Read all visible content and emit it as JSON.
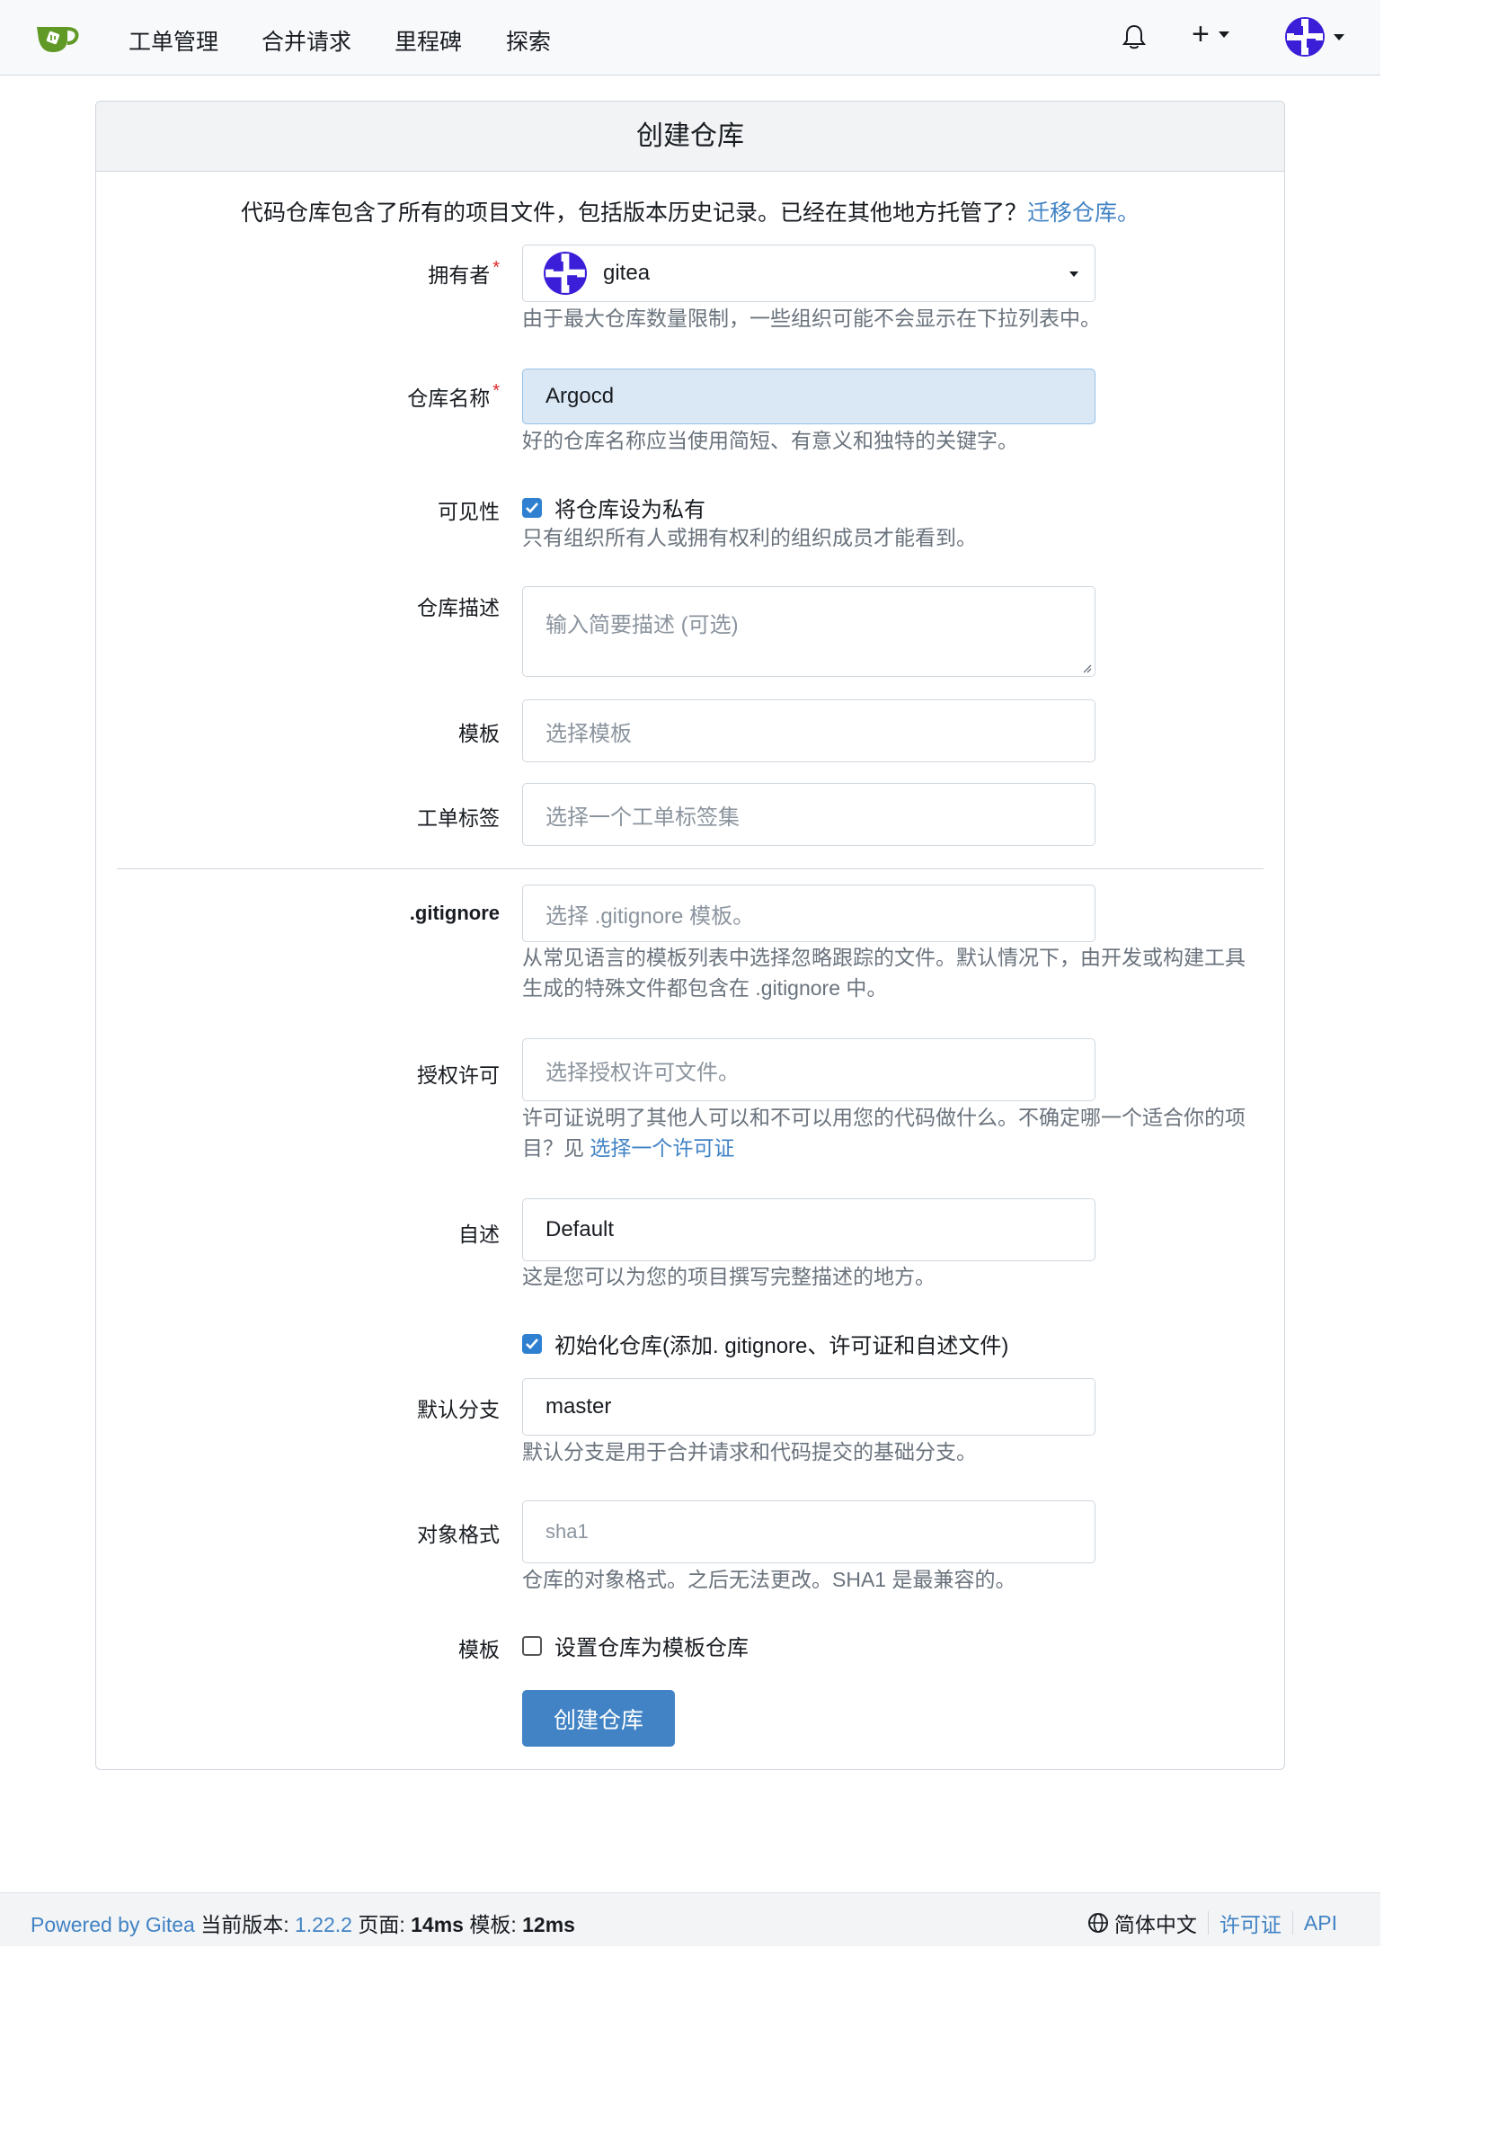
{
  "nav": {
    "items": [
      "工单管理",
      "合并请求",
      "里程碑",
      "探索"
    ],
    "plus_label": "+"
  },
  "page": {
    "title": "创建仓库",
    "intro_text": "代码仓库包含了所有的项目文件，包括版本历史记录。已经在其他地方托管了？",
    "intro_link": "迁移仓库。"
  },
  "form": {
    "owner": {
      "label": "拥有者",
      "value": "gitea",
      "help": "由于最大仓库数量限制，一些组织可能不会显示在下拉列表中。"
    },
    "repo_name": {
      "label": "仓库名称",
      "value": "Argocd",
      "help": "好的仓库名称应当使用简短、有意义和独特的关键字。"
    },
    "visibility": {
      "label": "可见性",
      "checkbox_label": "将仓库设为私有",
      "checked": true,
      "help": "只有组织所有人或拥有权利的组织成员才能看到。"
    },
    "description": {
      "label": "仓库描述",
      "placeholder": "输入简要描述 (可选)"
    },
    "template": {
      "label": "模板",
      "placeholder": "选择模板"
    },
    "issue_labels": {
      "label": "工单标签",
      "placeholder": "选择一个工单标签集"
    },
    "gitignore": {
      "label": ".gitignore",
      "placeholder": "选择 .gitignore 模板。",
      "help": "从常见语言的模板列表中选择忽略跟踪的文件。默认情况下，由开发或构建工具生成的特殊文件都包含在 .gitignore 中。"
    },
    "license": {
      "label": "授权许可",
      "placeholder": "选择授权许可文件。",
      "help": "许可证说明了其他人可以和不可以用您的代码做什么。不确定哪一个适合你的项目？见 ",
      "help_link": "选择一个许可证"
    },
    "readme": {
      "label": "自述",
      "value": "Default",
      "help": "这是您可以为您的项目撰写完整描述的地方。"
    },
    "auto_init": {
      "checkbox_label": "初始化仓库(添加. gitignore、许可证和自述文件)",
      "checked": true
    },
    "default_branch": {
      "label": "默认分支",
      "value": "master",
      "help": "默认分支是用于合并请求和代码提交的基础分支。"
    },
    "object_format": {
      "label": "对象格式",
      "value": "sha1",
      "help": "仓库的对象格式。之后无法更改。SHA1 是最兼容的。"
    },
    "template_repo": {
      "label": "模板",
      "checkbox_label": "设置仓库为模板仓库",
      "checked": false
    },
    "submit_label": "创建仓库"
  },
  "footer": {
    "powered": "Powered by Gitea",
    "version_label": "当前版本:",
    "version": "1.22.2",
    "page_label": "页面:",
    "page_time": "14ms",
    "template_label": "模板:",
    "template_time": "12ms",
    "language": "简体中文",
    "license_link": "许可证",
    "api_link": "API"
  },
  "colors": {
    "accent": "#4183c4",
    "avatar": "#3a1ed8",
    "logo_green": "#609926",
    "required": "#db2828"
  }
}
